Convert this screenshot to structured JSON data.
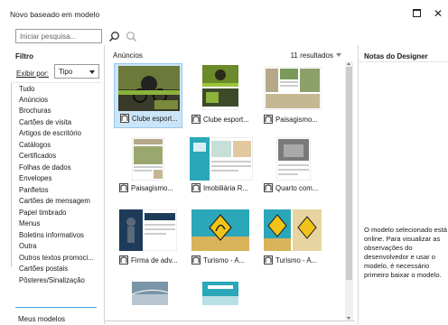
{
  "window": {
    "title": "Novo baseado em modelo",
    "maximize_icon": "maximize-icon",
    "close_glyph": "✕"
  },
  "search": {
    "placeholder": "Iniciar pesquisa...",
    "search_icon": "search-icon",
    "clear_icon": "zoom-icon"
  },
  "filter": {
    "title": "Filtro",
    "show_by_label": "Exibir por:",
    "show_by_value": "Tipo",
    "categories": [
      "Tudo",
      "Anúncios",
      "Brochuras",
      "Cartões de visita",
      "Artigos de escritório",
      "Catálogos",
      "Certificados",
      "Folhas de dados",
      "Envelopes",
      "Panfletos",
      "Cartões de mensagem",
      "Papel timbrado",
      "Menus",
      "Boletins informativos",
      "Outra",
      "Outros textos promoci...",
      "Cartões postais",
      "Pôsteres/Sinalização"
    ],
    "my_models": "Meus modelos"
  },
  "center": {
    "title": "Anúncios",
    "results": "11 resultados",
    "templates": [
      {
        "label": "Clube esport...",
        "selected": true
      },
      {
        "label": "Clube esport...",
        "selected": false
      },
      {
        "label": "Paisagismo...",
        "selected": false
      },
      {
        "label": "Paisagismo...",
        "selected": false
      },
      {
        "label": "Imobiliária R...",
        "selected": false
      },
      {
        "label": "Quarto com...",
        "selected": false
      },
      {
        "label": "Firma de adv...",
        "selected": false
      },
      {
        "label": "Turismo - A...",
        "selected": false
      },
      {
        "label": "Turismo - A...",
        "selected": false
      },
      {
        "label": "",
        "selected": false
      },
      {
        "label": "",
        "selected": false
      }
    ]
  },
  "designer": {
    "title": "Notas do Designer",
    "note": "O modelo selecionado está online. Para visualizar as observações do desenvolvedor e usar o modelo, é necessário primeiro baixar o modelo."
  },
  "colors": {
    "selection": "#cce4f7",
    "accent": "#4aa3df",
    "teal": "#2aa7b8"
  }
}
